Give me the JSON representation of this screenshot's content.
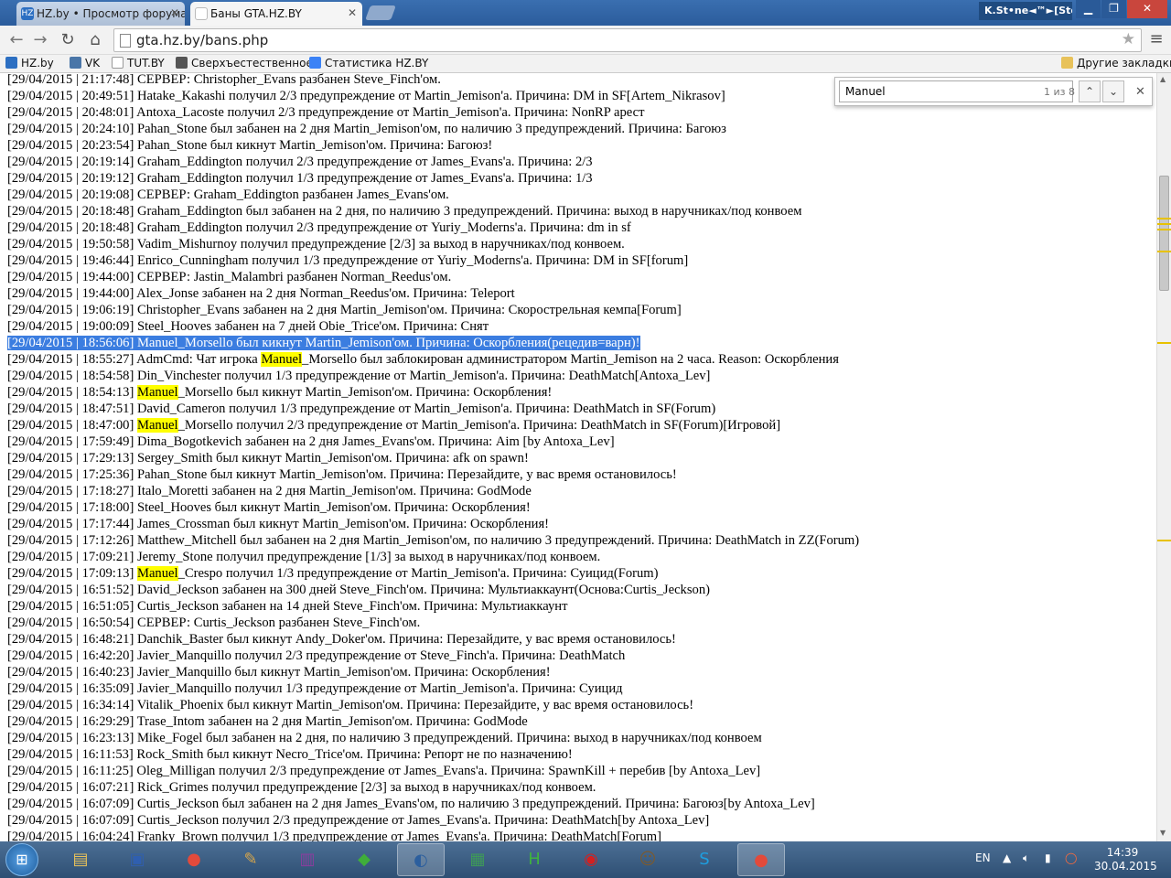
{
  "tabs": [
    {
      "title": "HZ.by • Просмотр форума"
    },
    {
      "title": "Баны GTA.HZ.BY"
    }
  ],
  "user_label": "K.St•ne◄™►[Sto...",
  "url": "gta.hz.by/bans.php",
  "bookmarks": [
    {
      "label": "HZ.by",
      "icon": "hz-icon",
      "color": "#2c6fc2"
    },
    {
      "label": "VK",
      "icon": "vk-icon",
      "color": "#4a76a8"
    },
    {
      "label": "TUT.BY",
      "icon": "page-icon",
      "color": "#ffffff"
    },
    {
      "label": "Сверхъестественное",
      "icon": "film-icon",
      "color": "#555555"
    },
    {
      "label": "Статистика HZ.BY",
      "icon": "google-icon",
      "color": "#3b82f6"
    }
  ],
  "other_bookmarks": "Другие закладки",
  "find": {
    "query": "Manuel",
    "count": "1 из 8"
  },
  "highlight_term": "Manuel",
  "selected_row": 16,
  "log": [
    "[29/04/2015 | 21:17:48] СЕРВЕР: Christopher_Evans разбанен Steve_Finch'ом.",
    "[29/04/2015 | 20:49:51] Hatake_Kakashi получил 2/3 предупреждение от Martin_Jemison'a. Причина: DM in SF[Artem_Nikrasov]",
    "[29/04/2015 | 20:48:01] Antoxa_Lacoste получил 2/3 предупреждение от Martin_Jemison'a. Причина: NonRP арест",
    "[29/04/2015 | 20:24:10] Pahan_Stone был забанен на 2 дня Martin_Jemison'ом, по наличию 3 предупреждений. Причина: Багоюз",
    "[29/04/2015 | 20:23:54] Pahan_Stone был кикнут Martin_Jemison'ом. Причина: Багоюз!",
    "[29/04/2015 | 20:19:14] Graham_Eddington получил 2/3 предупреждение от James_Evans'a. Причина: 2/3",
    "[29/04/2015 | 20:19:12] Graham_Eddington получил 1/3 предупреждение от James_Evans'a. Причина: 1/3",
    "[29/04/2015 | 20:19:08] СЕРВЕР: Graham_Eddington разбанен James_Evans'ом.",
    "[29/04/2015 | 20:18:48] Graham_Eddington был забанен на 2 дня, по наличию 3 предупреждений. Причина: выход в наручниках/под конвоем",
    "[29/04/2015 | 20:18:48] Graham_Eddington получил 2/3 предупреждение от Yuriy_Moderns'a. Причина: dm in sf",
    "[29/04/2015 | 19:50:58] Vadim_Mishurnoy получил предупреждение [2/3] за выход в наручниках/под конвоем.",
    "[29/04/2015 | 19:46:44] Enrico_Cunningham получил 1/3 предупреждение от Yuriy_Moderns'a. Причина: DM in SF[forum]",
    "[29/04/2015 | 19:44:00] СЕРВЕР: Jastin_Malambri разбанен Norman_Reedus'ом.",
    "[29/04/2015 | 19:44:00] Alex_Jonse забанен на 2 дня Norman_Reedus'ом. Причина: Teleport",
    "[29/04/2015 | 19:06:19] Christopher_Evans забанен на 2 дня Martin_Jemison'ом. Причина: Скорострельная кемпа[Forum]",
    "[29/04/2015 | 19:00:09] Steel_Hooves забанен на 7 дней Obie_Trice'ом. Причина: Снят",
    "[29/04/2015 | 18:56:06] Manuel_Morsello был кикнут Martin_Jemison'ом. Причина: Оскорбления(рецедив=варн)!",
    "[29/04/2015 | 18:55:27] AdmCmd: Чат игрока Manuel_Morsello был заблокирован администратором Martin_Jemison на 2 часа. Reason: Оскорбления",
    "[29/04/2015 | 18:54:58] Din_Vinchester получил 1/3 предупреждение от Martin_Jemison'a. Причина: DeathMatch[Antoxa_Lev]",
    "[29/04/2015 | 18:54:13] Manuel_Morsello был кикнут Martin_Jemison'ом. Причина: Оскорбления!",
    "[29/04/2015 | 18:47:51] David_Cameron получил 1/3 предупреждение от Martin_Jemison'a. Причина: DeathMatch in SF(Forum)",
    "[29/04/2015 | 18:47:00] Manuel_Morsello получил 2/3 предупреждение от Martin_Jemison'a. Причина: DeathMatch in SF(Forum)[Игровой]",
    "[29/04/2015 | 17:59:49] Dima_Bogotkevich забанен на 2 дня James_Evans'ом. Причина: Aim [by Antoxa_Lev]",
    "[29/04/2015 | 17:29:13] Sergey_Smith был кикнут Martin_Jemison'ом. Причина: afk on spawn!",
    "[29/04/2015 | 17:25:36] Pahan_Stone был кикнут Martin_Jemison'ом. Причина: Перезайдите, у вас время остановилось!",
    "[29/04/2015 | 17:18:27] Italo_Moretti забанен на 2 дня Martin_Jemison'ом. Причина: GodMode",
    "[29/04/2015 | 17:18:00] Steel_Hooves был кикнут Martin_Jemison'ом. Причина: Оскорбления!",
    "[29/04/2015 | 17:17:44] James_Crossman был кикнут Martin_Jemison'ом. Причина: Оскорбления!",
    "[29/04/2015 | 17:12:26] Matthew_Mitchell был забанен на 2 дня Martin_Jemison'ом, по наличию 3 предупреждений. Причина: DeathMatch in ZZ(Forum)",
    "[29/04/2015 | 17:09:21] Jeremy_Stone получил предупреждение [1/3] за выход в наручниках/под конвоем.",
    "[29/04/2015 | 17:09:13] Manuel_Crespo получил 1/3 предупреждение от Martin_Jemison'a. Причина: Суицид(Forum)",
    "[29/04/2015 | 16:51:52] David_Jeckson забанен на 300 дней Steve_Finch'ом. Причина: Мультиаккаунт(Основа:Curtis_Jeckson)",
    "[29/04/2015 | 16:51:05] Curtis_Jeckson забанен на 14 дней Steve_Finch'ом. Причина: Мультиаккаунт",
    "[29/04/2015 | 16:50:54] СЕРВЕР: Curtis_Jeckson разбанен Steve_Finch'ом.",
    "[29/04/2015 | 16:48:21] Danchik_Baster был кикнут Andy_Doker'ом. Причина: Перезайдите, у вас время остановилось!",
    "[29/04/2015 | 16:42:20] Javier_Manquillo получил 2/3 предупреждение от Steve_Finch'a. Причина: DeathMatch",
    "[29/04/2015 | 16:40:23] Javier_Manquillo был кикнут Martin_Jemison'ом. Причина: Оскорбления!",
    "[29/04/2015 | 16:35:09] Javier_Manquillo получил 1/3 предупреждение от Martin_Jemison'a. Причина: Суицид",
    "[29/04/2015 | 16:34:14] Vitalik_Phoenix был кикнут Martin_Jemison'ом. Причина: Перезайдите, у вас время остановилось!",
    "[29/04/2015 | 16:29:29] Trase_Intom забанен на 2 дня Martin_Jemison'ом. Причина: GodMode",
    "[29/04/2015 | 16:23:13] Mike_Fogel был забанен на 2 дня, по наличию 3 предупреждений. Причина: выход в наручниках/под конвоем",
    "[29/04/2015 | 16:11:53] Rock_Smith был кикнут Necro_Trice'ом. Причина: Репорт не по назначению!",
    "[29/04/2015 | 16:11:25] Oleg_Milligan получил 2/3 предупреждение от James_Evans'a. Причина: SpawnKill + перебив [by Antoxa_Lev]",
    "[29/04/2015 | 16:07:21] Rick_Grimes получил предупреждение [2/3] за выход в наручниках/под конвоем.",
    "[29/04/2015 | 16:07:09] Curtis_Jeckson был забанен на 2 дня James_Evans'ом, по наличию 3 предупреждений. Причина: Багоюз[by Antoxa_Lev]",
    "[29/04/2015 | 16:07:09] Curtis_Jeckson получил 2/3 предупреждение от James_Evans'a. Причина: DeathMatch[by Antoxa_Lev]",
    "[29/04/2015 | 16:04:24] Franky_Brown получил 1/3 предупреждение от James_Evans'a. Причина: DeathMatch[Forum]"
  ],
  "taskbar": [
    {
      "name": "explorer-icon",
      "glyph": "▤",
      "color": "#e8c25a"
    },
    {
      "name": "save-icon",
      "glyph": "▣",
      "color": "#2f5fb0"
    },
    {
      "name": "chrome-icon",
      "glyph": "●",
      "color": "#e24a3b"
    },
    {
      "name": "paint-icon",
      "glyph": "✎",
      "color": "#d7a64a"
    },
    {
      "name": "winrar-icon",
      "glyph": "▥",
      "color": "#8a3e9e"
    },
    {
      "name": "qip-icon",
      "glyph": "◆",
      "color": "#3fae3a"
    },
    {
      "name": "samp-icon",
      "glyph": "◐",
      "color": "#2c5f9e",
      "active": true
    },
    {
      "name": "notepad-icon",
      "glyph": "▦",
      "color": "#3e9a58"
    },
    {
      "name": "h-app-icon",
      "glyph": "H",
      "color": "#3fb23f"
    },
    {
      "name": "record-icon",
      "glyph": "◉",
      "color": "#d32020"
    },
    {
      "name": "gta-icon",
      "glyph": "☺",
      "color": "#7a5a30"
    },
    {
      "name": "skype-icon",
      "glyph": "S",
      "color": "#1e9ee0"
    },
    {
      "name": "chrome-active-icon",
      "glyph": "●",
      "color": "#e24a3b",
      "active": true
    }
  ],
  "tray": {
    "lang": "EN",
    "time": "14:39",
    "date": "30.04.2015"
  }
}
